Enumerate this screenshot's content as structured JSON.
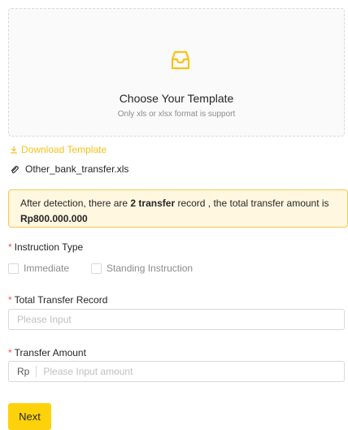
{
  "upload": {
    "title": "Choose Your Template",
    "hint": "Only xls or xlsx format is support",
    "icon": "inbox-icon",
    "icon_color": "#f8c21a"
  },
  "download_link": {
    "label": "Download Template",
    "icon": "download-icon",
    "color": "#f8c21a"
  },
  "file": {
    "name": "Other_bank_transfer.xls",
    "icon": "paperclip-icon"
  },
  "detection": {
    "text_before": "After detection, there are ",
    "count": "2 transfer",
    "text_middle": " record , the total transfer amount is ",
    "amount": "Rp800.000.000",
    "background": "#fff7e0",
    "border": "#f5c74d"
  },
  "instruction_type": {
    "required_mark": "*",
    "label": "Instruction Type",
    "options": [
      "Immediate",
      "Standing Instruction"
    ]
  },
  "total_record": {
    "required_mark": "*",
    "label": "Total Transfer Record",
    "placeholder": "Please Input"
  },
  "transfer_amount": {
    "required_mark": "*",
    "label": "Transfer Amount",
    "prefix": "Rp",
    "placeholder": "Please Input amount"
  },
  "next_button": {
    "label": "Next",
    "color": "#fdd20a"
  }
}
